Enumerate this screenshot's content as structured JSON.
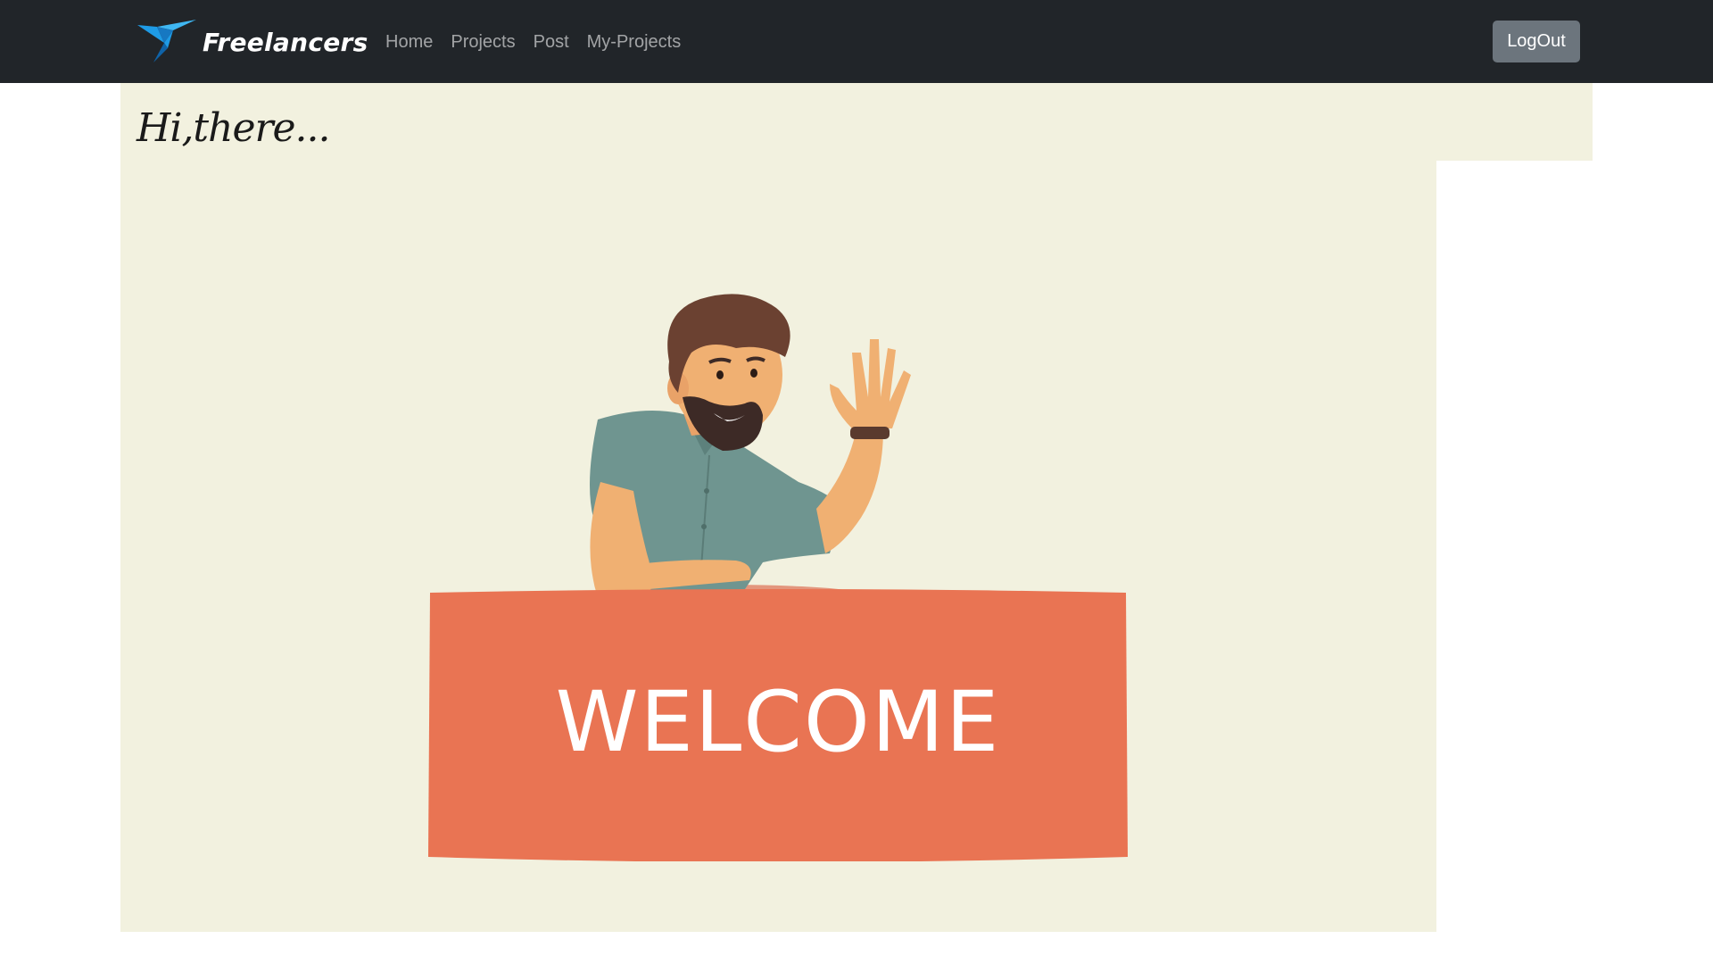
{
  "navbar": {
    "brand": "Freelancers",
    "links": [
      "Home",
      "Projects",
      "Post",
      "My-Projects"
    ],
    "logout_label": "LogOut"
  },
  "greeting": "Hi,there...",
  "hero": {
    "sign_text": "WELCOME"
  },
  "colors": {
    "navbar_bg": "#212529",
    "page_accent_bg": "#f2f1df",
    "sign_color": "#e97453",
    "logout_bg": "#6c757d",
    "logo_blue": "#1e9be6"
  }
}
